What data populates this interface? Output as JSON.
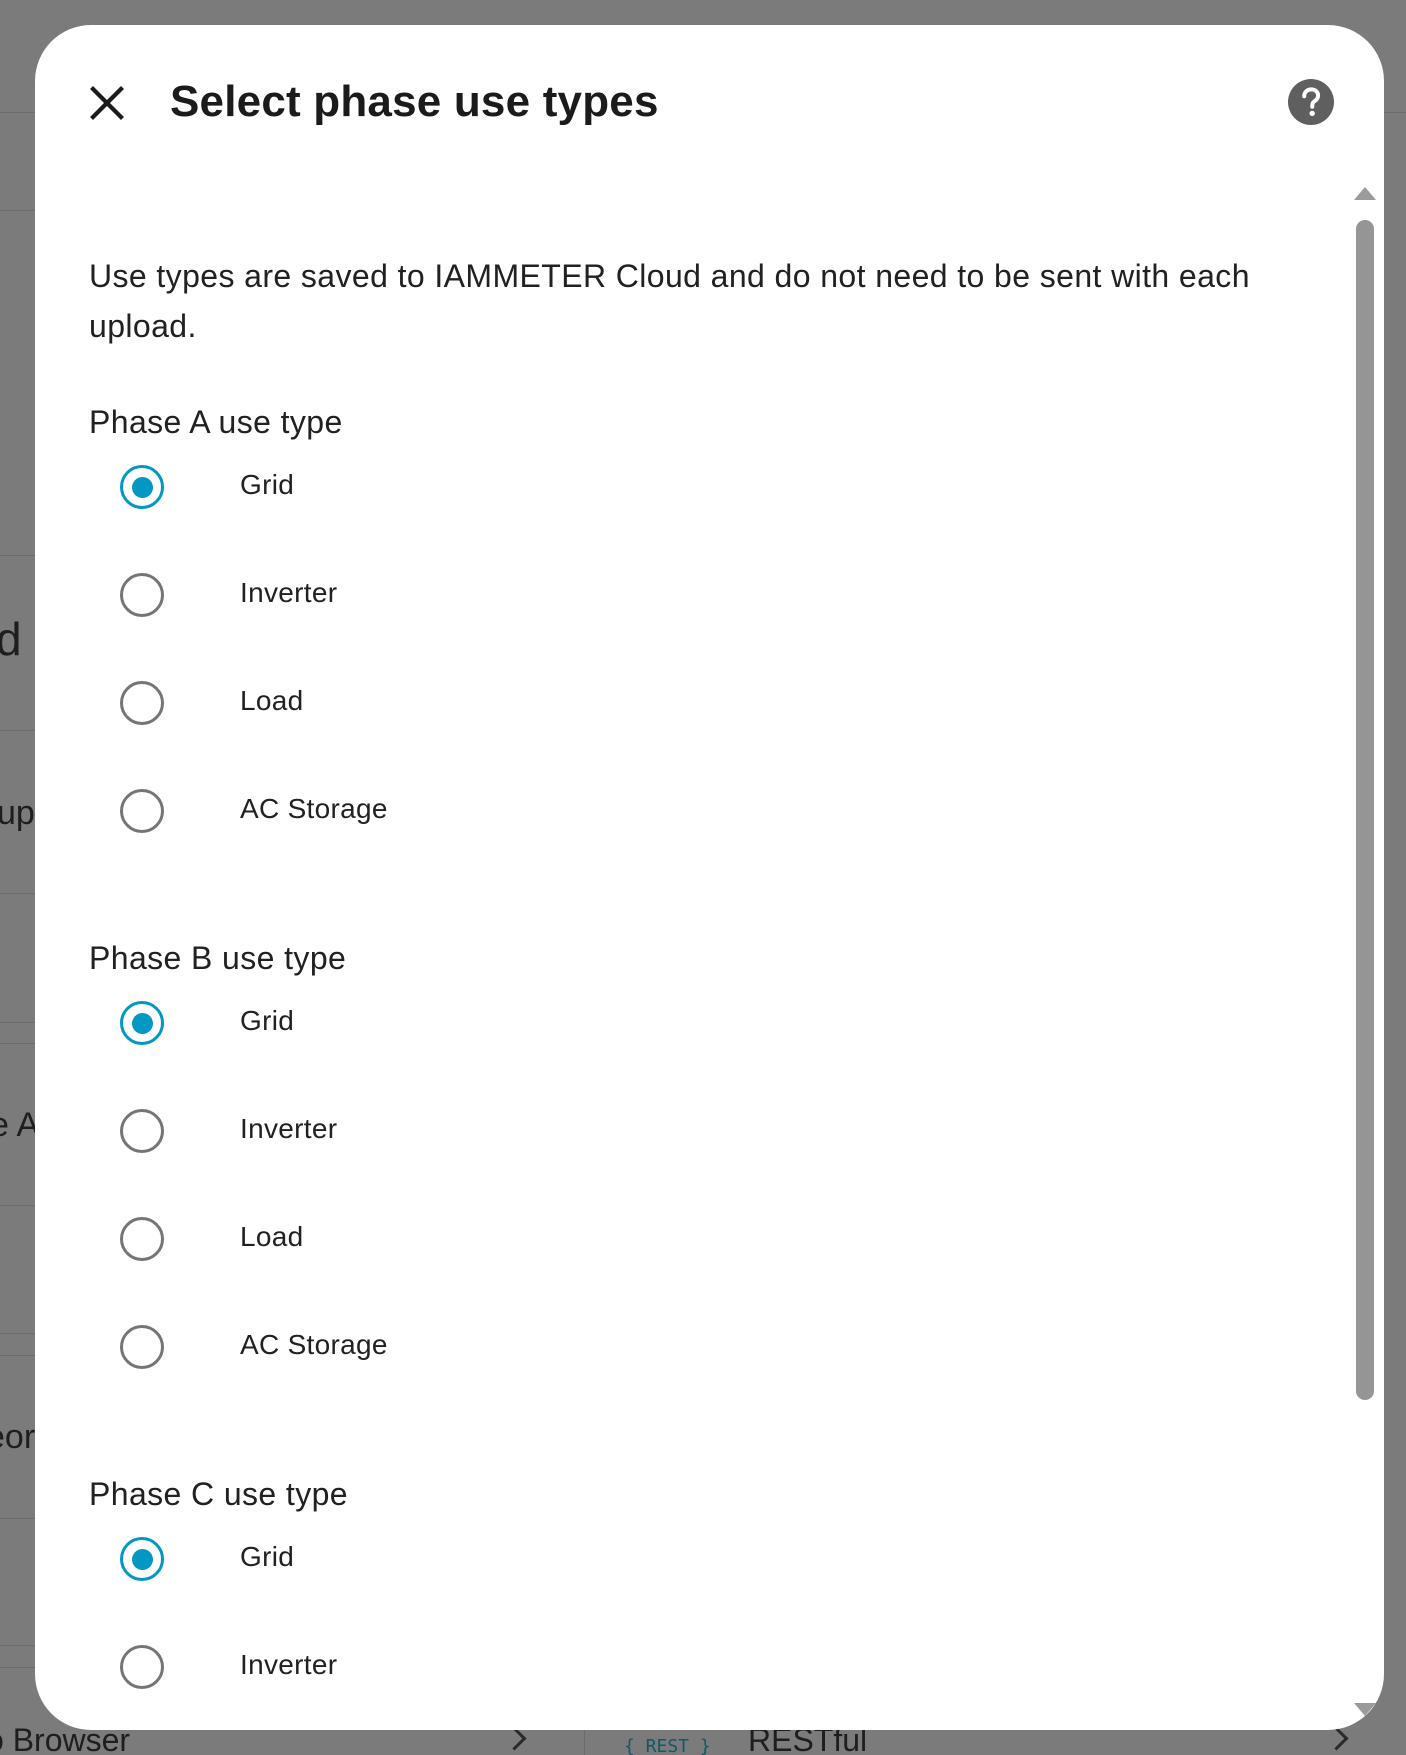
{
  "background": {
    "fragments": [
      "d",
      "kup",
      "e A",
      "eor"
    ],
    "bottom_left_text": "o Browser",
    "bottom_tag": "{ REST }",
    "bottom_right_text": "RESTful"
  },
  "dialog": {
    "title": "Select phase use types",
    "close_icon": "close-icon",
    "help_icon": "help-icon",
    "description": "Use types are saved to IAMMETER Cloud and do not need to be sent with each upload.",
    "accent_color": "#0398c4",
    "groups": [
      {
        "label": "Phase A use type",
        "options": [
          "Grid",
          "Inverter",
          "Load",
          "AC Storage"
        ],
        "selected": "Grid"
      },
      {
        "label": "Phase B use type",
        "options": [
          "Grid",
          "Inverter",
          "Load",
          "AC Storage"
        ],
        "selected": "Grid"
      },
      {
        "label": "Phase C use type",
        "options": [
          "Grid",
          "Inverter"
        ],
        "selected": "Grid"
      }
    ]
  }
}
